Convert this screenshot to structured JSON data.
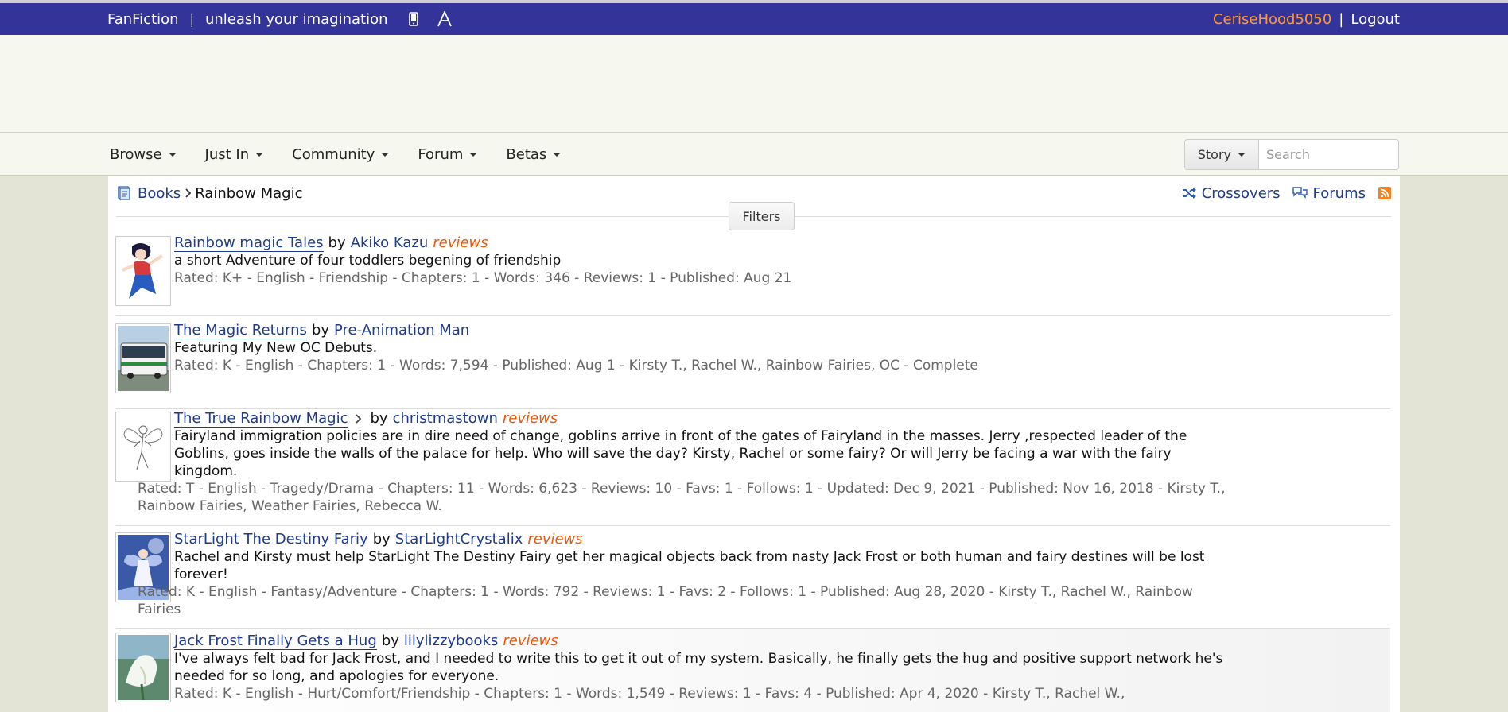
{
  "topbar": {
    "brand": "FanFiction",
    "separator": "|",
    "tagline": "unleash your imagination",
    "icons": [
      "mobile-icon",
      "text-size-icon"
    ],
    "username": "CeriseHood5050",
    "divider": "|",
    "logout": "Logout",
    "colors": {
      "bar": "#333399",
      "username": "#ff9933"
    }
  },
  "nav": {
    "items": [
      {
        "label": "Browse"
      },
      {
        "label": "Just In"
      },
      {
        "label": "Community"
      },
      {
        "label": "Forum"
      },
      {
        "label": "Betas"
      }
    ],
    "search_type": "Story",
    "search_placeholder": "Search"
  },
  "breadcrumb": {
    "root": "Books",
    "current": "Rainbow Magic"
  },
  "links": {
    "crossovers": "Crossovers",
    "forums": "Forums"
  },
  "filters_label": "Filters",
  "stories": [
    {
      "title": "Rainbow magic Tales",
      "by": "by",
      "author": "Akiko Kazu",
      "reviews": "reviews",
      "summary": "a short Adventure of four toddlers begening of friendship",
      "meta": "Rated: K+ - English - Friendship - Chapters: 1 - Words: 346 - Reviews: 1 - Published: Aug 21"
    },
    {
      "title": "The Magic Returns",
      "by": "by",
      "author": "Pre-Animation Man",
      "reviews": "",
      "summary": "Featuring My New OC Debuts.",
      "meta": "Rated: K - English - Chapters: 1 - Words: 7,594 - Published: Aug 1 - Kirsty T., Rachel W., Rainbow Fairies, OC - Complete"
    },
    {
      "title": "The True Rainbow Magic",
      "by": "by",
      "author": "christmastown",
      "reviews": "reviews",
      "summary": "Fairyland immigration policies are in dire need of change, goblins arrive in front of the gates of Fairyland in the masses. Jerry ,respected leader of the Goblins, goes inside the walls of the palace for help. Who will save the day? Kirsty, Rachel or some fairy? Or will Jerry be facing a war with the fairy kingdom.",
      "meta": "Rated: T - English - Tragedy/Drama - Chapters: 11 - Words: 6,623 - Reviews: 10 - Favs: 1 - Follows: 1 - Updated: Dec 9, 2021 - Published: Nov 16, 2018 - Kirsty T., Rainbow Fairies, Weather Fairies, Rebecca W."
    },
    {
      "title": "StarLight The Destiny Fariy",
      "by": "by",
      "author": "StarLightCrystalix",
      "reviews": "reviews",
      "summary": "Rachel and Kirsty must help StarLight The Destiny Fairy get her magical objects back from nasty Jack Frost or both human and fairy destines will be lost forever!",
      "meta": "Rated: K - English - Fantasy/Adventure - Chapters: 1 - Words: 792 - Reviews: 1 - Favs: 2 - Follows: 1 - Published: Aug 28, 2020 - Kirsty T., Rachel W., Rainbow Fairies"
    },
    {
      "title": "Jack Frost Finally Gets a Hug",
      "by": "by",
      "author": "lilylizzybooks",
      "reviews": "reviews",
      "summary": "I've always felt bad for Jack Frost, and I needed to write this to get it out of my system. Basically, he finally gets the hug and positive support network he's needed for so long, and apologies for everyone.",
      "meta": "Rated: K - English - Hurt/Comfort/Friendship - Chapters: 1 - Words: 1,549 - Reviews: 1 - Favs: 4 - Published: Apr 4, 2020 - Kirsty T., Rachel W.,"
    }
  ]
}
